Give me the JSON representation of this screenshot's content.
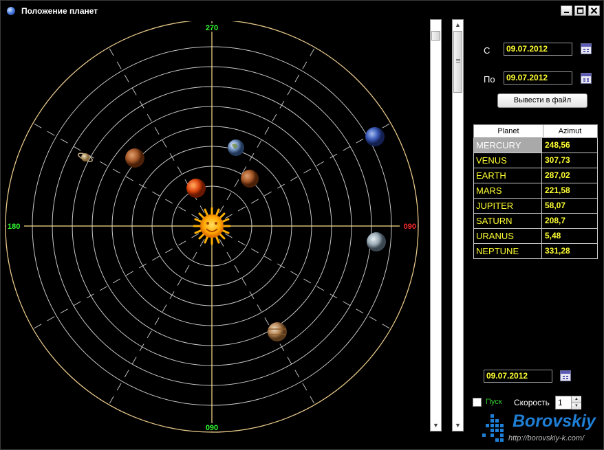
{
  "window": {
    "title": "Положение планет"
  },
  "chart": {
    "labels": {
      "top": "270",
      "bottom": "090",
      "left": "180",
      "right": "090"
    },
    "colors": {
      "ring": "#c8c8c8",
      "outer_ring": "#e8c98a",
      "axes": "#ffe08a",
      "spokes": "#bfbfbf",
      "label_green": "#33ff33",
      "label_red": "#ff2a2a"
    }
  },
  "planets": [
    {
      "name": "MERCURY",
      "azimut": "248,56"
    },
    {
      "name": "VENUS",
      "azimut": "307,73"
    },
    {
      "name": "EARTH",
      "azimut": "287,02"
    },
    {
      "name": "MARS",
      "azimut": "221,58"
    },
    {
      "name": "JUPITER",
      "azimut": "58,07"
    },
    {
      "name": "SATURN",
      "azimut": "208,7"
    },
    {
      "name": "URANUS",
      "azimut": "5,48"
    },
    {
      "name": "NEPTUNE",
      "azimut": "331,28"
    }
  ],
  "controls": {
    "from_label": "С",
    "from_date": "09.07.2012",
    "to_label": "По",
    "to_date": "09.07.2012",
    "export_button": "Вывести в файл",
    "table_headers": {
      "planet": "Planet",
      "azimut": "Azimut"
    },
    "current_date": "09.07.2012",
    "start_label": "Пуск",
    "speed_label": "Скорость",
    "speed_value": "1"
  },
  "logo": {
    "text": "Borovskiy",
    "url": "http://borovskiy-k.com/"
  }
}
